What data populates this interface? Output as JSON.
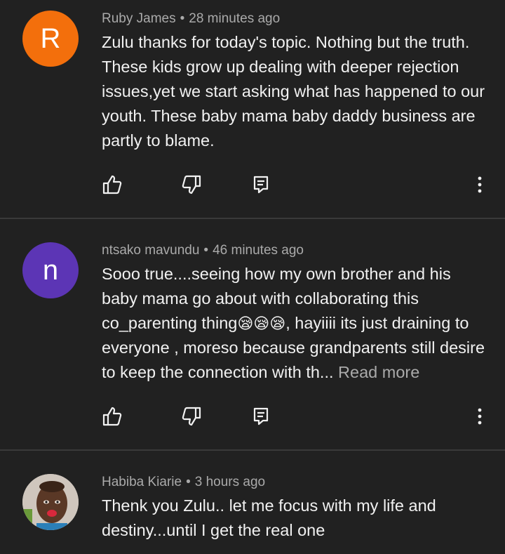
{
  "comments": [
    {
      "author": "Ruby James",
      "time": "28 minutes ago",
      "avatar_letter": "R",
      "avatar_color": "#f36f0c",
      "text": "Zulu thanks for today's topic. Nothing but the truth. These kids grow up dealing with deeper rejection issues,yet we start asking what has happened to our youth. These baby mama baby daddy business are partly to blame."
    },
    {
      "author": "ntsako mavundu",
      "time": "46 minutes ago",
      "avatar_letter": "n",
      "avatar_color": "#5c35b5",
      "text_before": "Sooo true....seeing how my own brother and his baby mama  go about with collaborating this co_parenting thing",
      "emojis": "😪😪😪",
      "text_after": ", hayiiii its just draining to everyone , moreso because grandparents  still desire to keep the connection with th...",
      "read_more": "Read more"
    },
    {
      "author": "Habiba Kiarie",
      "time": "3 hours ago",
      "text": "Thenk you Zulu.. let me focus with my life and destiny...until I get the real one"
    }
  ],
  "separator": "•",
  "icons": [
    "like-icon",
    "dislike-icon",
    "reply-icon",
    "more-options-icon"
  ]
}
